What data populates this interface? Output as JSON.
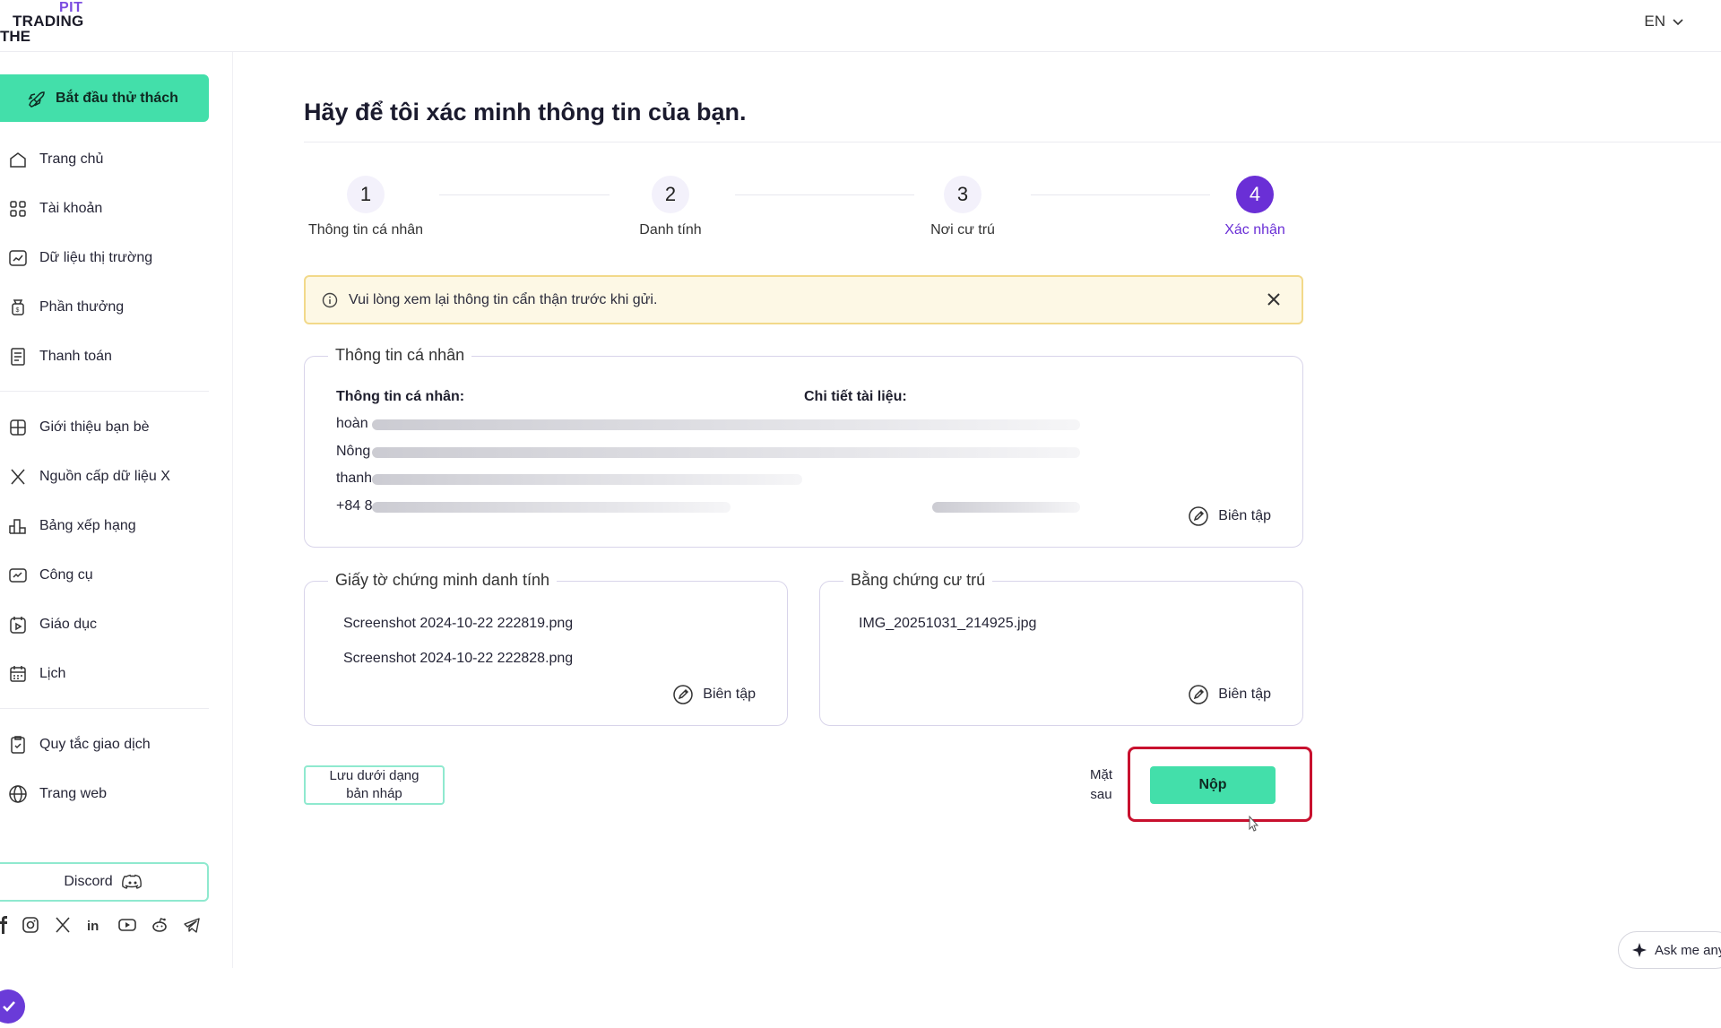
{
  "header": {
    "logo": {
      "line1": "PIT",
      "line2": "TRADING",
      "line3": "THE"
    },
    "language": "EN"
  },
  "sidebar": {
    "start_challenge": "Bắt đầu thử thách",
    "items": [
      {
        "label": "Trang chủ",
        "icon": "home-icon"
      },
      {
        "label": "Tài khoản",
        "icon": "grid-icon"
      },
      {
        "label": "Dữ liệu thị trường",
        "icon": "chart-icon"
      },
      {
        "label": "Phần thưởng",
        "icon": "reward-bag-icon"
      },
      {
        "label": "Thanh toán",
        "icon": "receipt-icon"
      },
      {
        "label": "Giới thiệu bạn bè",
        "icon": "gift-icon"
      },
      {
        "label": "Nguồn cấp dữ liệu X",
        "icon": "x-logo-icon"
      },
      {
        "label": "Bảng xếp hạng",
        "icon": "leaderboard-icon"
      },
      {
        "label": "Công cụ",
        "icon": "tools-icon"
      },
      {
        "label": "Giáo dục",
        "icon": "education-icon"
      },
      {
        "label": "Lịch",
        "icon": "calendar-icon"
      },
      {
        "label": "Quy tắc giao dịch",
        "icon": "rules-clipboard-icon"
      },
      {
        "label": "Trang web",
        "icon": "globe-icon"
      }
    ],
    "discord": "Discord",
    "socials": [
      "facebook-icon",
      "instagram-icon",
      "x-icon",
      "linkedin-icon",
      "youtube-icon",
      "reddit-icon",
      "telegram-icon"
    ]
  },
  "main": {
    "title": "Hãy để tôi xác minh thông tin của bạn.",
    "steps": [
      {
        "num": "1",
        "label": "Thông tin cá nhân"
      },
      {
        "num": "2",
        "label": "Danh tính"
      },
      {
        "num": "3",
        "label": "Nơi cư trú"
      },
      {
        "num": "4",
        "label": "Xác nhận"
      }
    ],
    "alert": "Vui lòng xem lại thông tin cẩn thận trước khi gửi.",
    "personal_card": {
      "title": "Thông tin cá nhân",
      "left_head": "Thông tin cá nhân:",
      "right_head": "Chi tiết tài liệu:",
      "lines": [
        "hoàn",
        "Nông",
        "thanh",
        "+84 8"
      ],
      "edit": "Biên tập"
    },
    "identity_card": {
      "title": "Giấy tờ chứng minh danh tính",
      "files": [
        "Screenshot 2024-10-22 222819.png",
        "Screenshot 2024-10-22 222828.png"
      ],
      "edit": "Biên tập"
    },
    "residence_card": {
      "title": "Bằng chứng cư trú",
      "files": [
        "IMG_20251031_214925.jpg"
      ],
      "edit": "Biên tập"
    },
    "buttons": {
      "draft_line1": "Lưu dưới dạng",
      "draft_line2": "bản nháp",
      "later_line1": "Mặt",
      "later_line2": "sau",
      "submit": "Nộp"
    }
  },
  "assistant": {
    "label": "Ask me any"
  },
  "colors": {
    "accent_green": "#43dfaa",
    "accent_purple": "#6a2fd6",
    "alert_bg": "#fdf8e5",
    "highlight_red": "#c8102e"
  }
}
